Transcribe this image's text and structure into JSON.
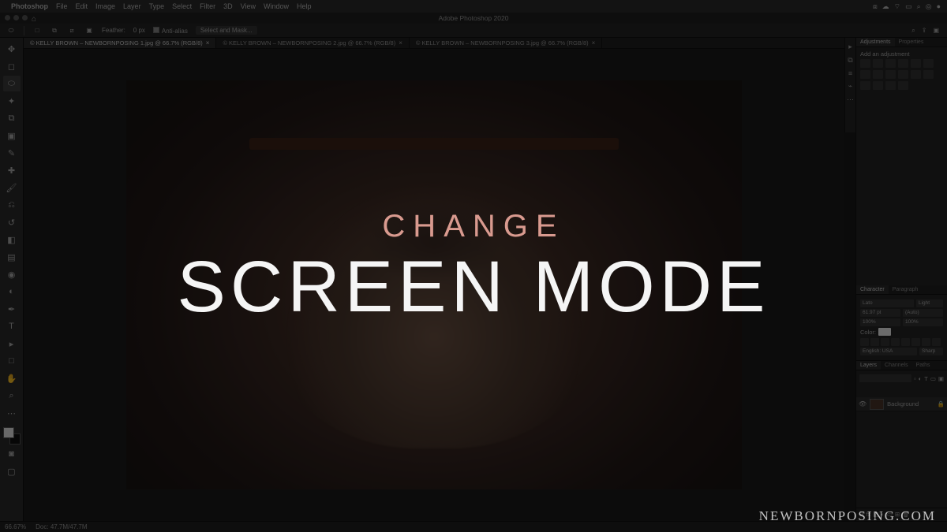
{
  "mac_menu": {
    "app_name": "Photoshop",
    "items": [
      "File",
      "Edit",
      "Image",
      "Layer",
      "Type",
      "Select",
      "Filter",
      "3D",
      "View",
      "Window",
      "Help"
    ]
  },
  "window_title": "Adobe Photoshop 2020",
  "options_bar": {
    "feather_label": "Feather:",
    "feather_value": "0 px",
    "antialias_label": "Anti-alias",
    "select_mask_label": "Select and Mask..."
  },
  "doc_tabs": [
    {
      "label": "© KELLY BROWN – NEWBORNPOSING 1.jpg @ 66.7% (RGB/8)",
      "active": true
    },
    {
      "label": "© KELLY BROWN – NEWBORNPOSING 2.jpg @ 66.7% (RGB/8)",
      "active": false
    },
    {
      "label": "© KELLY BROWN – NEWBORNPOSING 3.jpg @ 66.7% (RGB/8)",
      "active": false
    }
  ],
  "adjustments": {
    "tab1": "Adjustments",
    "tab2": "Properties",
    "heading": "Add an adjustment"
  },
  "character": {
    "tab1": "Character",
    "tab2": "Paragraph",
    "font_family": "Lato",
    "font_style": "Light",
    "font_size": "61.97 pt",
    "leading": "(Auto)",
    "tracking": "100%",
    "baseline": "100%",
    "color_label": "Color:",
    "lang": "English: USA",
    "aa": "Sharp"
  },
  "layers": {
    "tab1": "Layers",
    "tab2": "Channels",
    "tab3": "Paths",
    "layer_name": "Background"
  },
  "status": {
    "zoom": "66.67%",
    "info": "Doc: 47.7M/47.7M"
  },
  "overlay": {
    "line1": "CHANGE",
    "line2": "SCREEN MODE"
  },
  "watermark": "NEWBORNPOSING.COM"
}
